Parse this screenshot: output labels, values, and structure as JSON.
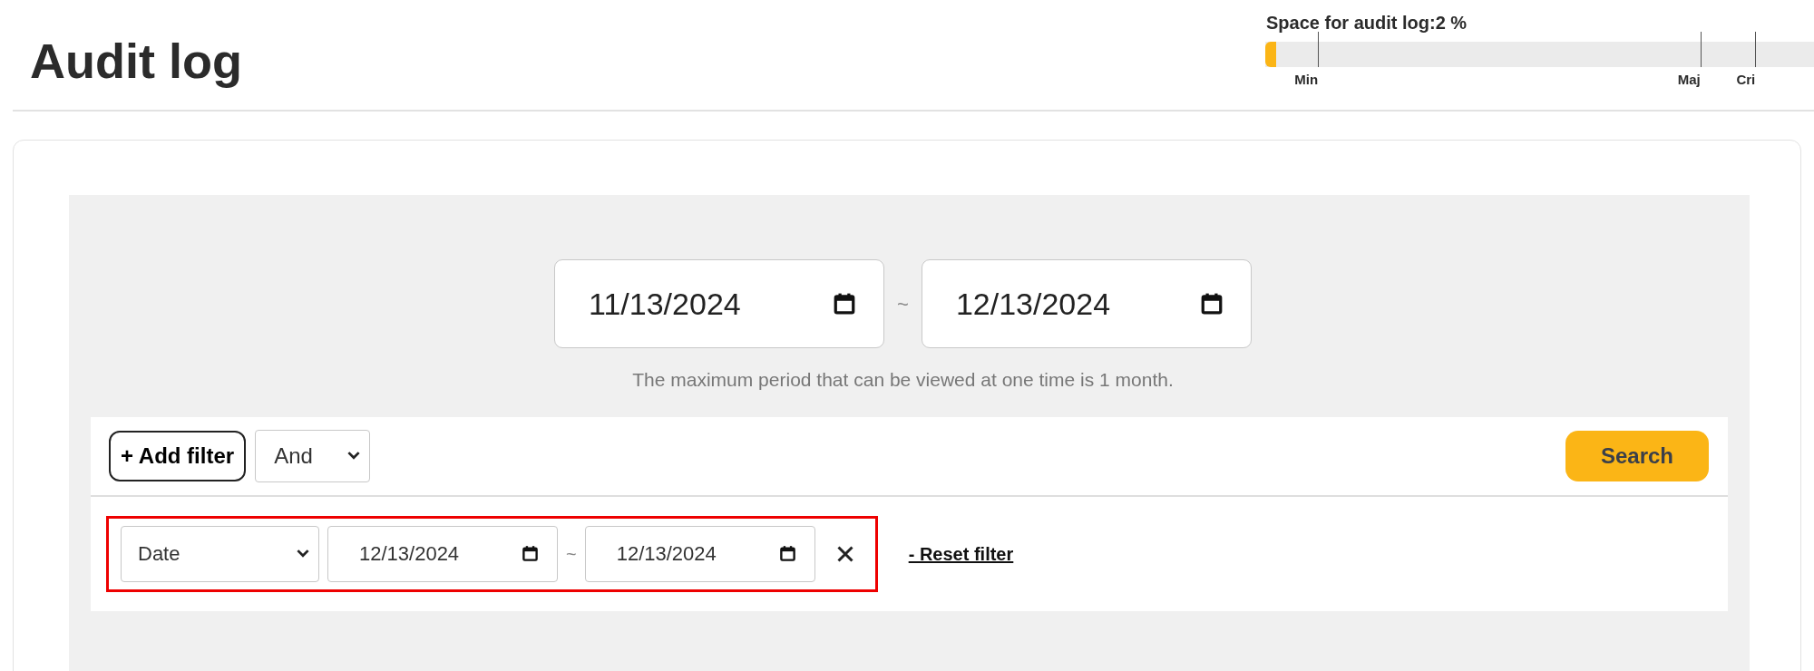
{
  "header": {
    "title": "Audit log"
  },
  "usage": {
    "label": "Space for audit log:2 %",
    "level": 0.02,
    "thresholds": [
      {
        "label": "Min"
      },
      {
        "label": "Maj"
      },
      {
        "label": "Cri"
      }
    ]
  },
  "period": {
    "from": "11/13/2024",
    "separator": "~",
    "to": "12/13/2024",
    "note": "The maximum period that can be viewed at one time is 1 month."
  },
  "toolbar": {
    "add_filter": "+ Add filter",
    "operator": "And",
    "search": "Search"
  },
  "filters": [
    {
      "field": "Date",
      "from": "12/13/2024",
      "separator": "~",
      "to": "12/13/2024",
      "highlighted": true
    }
  ],
  "reset": "- Reset filter"
}
